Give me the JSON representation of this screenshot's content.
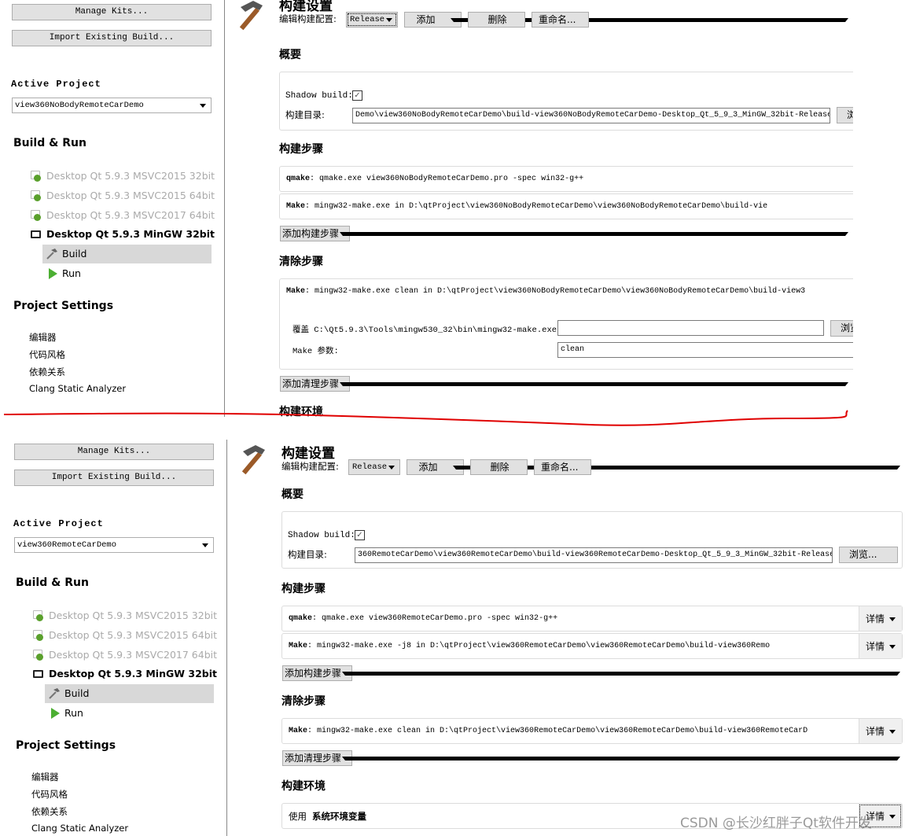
{
  "panels": [
    {
      "sidebar": {
        "manage_kits": "Manage Kits...",
        "import_build": "Import Existing Build...",
        "active_project_label": "Active Project",
        "active_project": "view360NoBodyRemoteCarDemo",
        "build_run_label": "Build & Run",
        "kits": [
          "Desktop Qt 5.9.3 MSVC2015 32bit",
          "Desktop Qt 5.9.3 MSVC2015 64bit",
          "Desktop Qt 5.9.3 MSVC2017 64bit"
        ],
        "active_kit": "Desktop Qt 5.9.3 MinGW 32bit",
        "build": "Build",
        "run": "Run",
        "project_settings_label": "Project Settings",
        "settings": [
          "编辑器",
          "代码风格",
          "依赖关系",
          "Clang Static Analyzer"
        ]
      },
      "main": {
        "title": "构建设置",
        "edit_config_label": "编辑构建配置:",
        "config": "Release",
        "add": "添加",
        "remove": "删除",
        "rename": "重命名...",
        "overview": "概要",
        "shadow_build_label": "Shadow build:",
        "shadow_build": true,
        "build_dir_label": "构建目录:",
        "build_dir": "Demo\\view360NoBodyRemoteCarDemo\\build-view360NoBodyRemoteCarDemo-Desktop_Qt_5_9_3_MinGW_32bit-Release",
        "browse": "浏览...",
        "build_steps_label": "构建步骤",
        "build_steps": [
          {
            "name": "qmake",
            "text": ": qmake.exe view360NoBodyRemoteCarDemo.pro -spec win32-g++"
          },
          {
            "name": "Make",
            "text": ": mingw32-make.exe in D:\\qtProject\\view360NoBodyRemoteCarDemo\\view360NoBodyRemoteCarDemo\\build-vie"
          }
        ],
        "add_build_step": "添加构建步骤",
        "clean_steps_label": "清除步骤",
        "clean_steps": [
          {
            "name": "Make",
            "text": ": mingw32-make.exe clean in D:\\qtProject\\view360NoBodyRemoteCarDemo\\view360NoBodyRemoteCarDemo\\build-view3"
          }
        ],
        "override_label": "覆盖 C:\\Qt5.9.3\\Tools\\mingw530_32\\bin\\mingw32-make.exe:",
        "override_value": "",
        "make_args_label": "Make 参数:",
        "make_args": "clean",
        "add_clean_step": "添加清理步骤",
        "build_env_label": "构建环境"
      }
    },
    {
      "sidebar": {
        "manage_kits": "Manage Kits...",
        "import_build": "Import Existing Build...",
        "active_project_label": "Active Project",
        "active_project": "view360RemoteCarDemo",
        "build_run_label": "Build & Run",
        "kits": [
          "Desktop Qt 5.9.3 MSVC2015 32bit",
          "Desktop Qt 5.9.3 MSVC2015 64bit",
          "Desktop Qt 5.9.3 MSVC2017 64bit"
        ],
        "active_kit": "Desktop Qt 5.9.3 MinGW 32bit",
        "build": "Build",
        "run": "Run",
        "project_settings_label": "Project Settings",
        "settings": [
          "编辑器",
          "代码风格",
          "依赖关系",
          "Clang Static Analyzer"
        ]
      },
      "main": {
        "title": "构建设置",
        "edit_config_label": "编辑构建配置:",
        "config": "Release",
        "add": "添加",
        "remove": "删除",
        "rename": "重命名...",
        "overview": "概要",
        "shadow_build_label": "Shadow build:",
        "shadow_build": true,
        "build_dir_label": "构建目录:",
        "build_dir": "360RemoteCarDemo\\view360RemoteCarDemo\\build-view360RemoteCarDemo-Desktop_Qt_5_9_3_MinGW_32bit-Release",
        "browse": "浏览...",
        "build_steps_label": "构建步骤",
        "build_steps": [
          {
            "name": "qmake",
            "text": ": qmake.exe view360RemoteCarDemo.pro -spec win32-g++"
          },
          {
            "name": "Make",
            "text": ": mingw32-make.exe -j8 in D:\\qtProject\\view360RemoteCarDemo\\view360RemoteCarDemo\\build-view360Remo"
          }
        ],
        "details": "详情",
        "add_build_step": "添加构建步骤",
        "clean_steps_label": "清除步骤",
        "clean_steps": [
          {
            "name": "Make",
            "text": ": mingw32-make.exe clean in D:\\qtProject\\view360RemoteCarDemo\\view360RemoteCarDemo\\build-view360RemoteCarD"
          }
        ],
        "add_clean_step": "添加清理步骤",
        "build_env_label": "构建环境",
        "env_prefix": "使用",
        "env_value": "系统环境变量"
      }
    }
  ],
  "watermark": "CSDN @长沙红胖子Qt软件开发",
  "colors": {
    "separator_line": "#e00000",
    "selection": "#d8d8d8",
    "kit_icon_green": "#5aa02c",
    "run_green": "#4caf32"
  }
}
